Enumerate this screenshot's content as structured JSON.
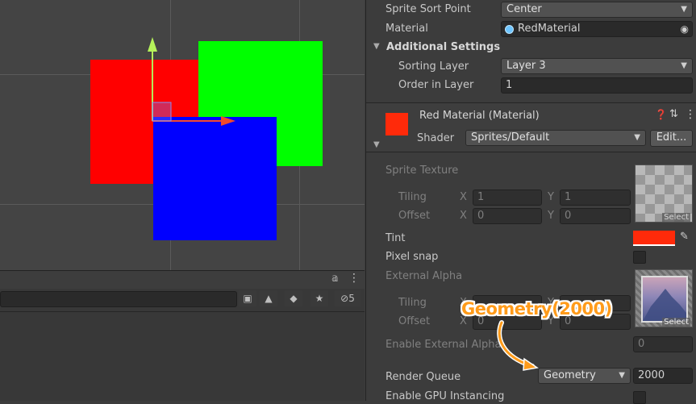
{
  "scene": {
    "colors": {
      "red": "#ff0000",
      "green": "#00ff00",
      "blue": "#0000ff",
      "background": "#444444"
    },
    "gizmo": {
      "y_axis_color": "#b5f25a",
      "x_axis_color": "#f14a2c"
    }
  },
  "lower_panel": {
    "corner_icons": [
      "account-icon",
      "more-vert-icon"
    ],
    "toolbar_icons": [
      "search-scene-icon",
      "shapes-icon",
      "tag-icon",
      "favorite-icon",
      "visibility-off-icon"
    ],
    "hidden_count": "5"
  },
  "inspector": {
    "sprite_sort_point": {
      "label": "Sprite Sort Point",
      "value": "Center"
    },
    "material": {
      "label": "Material",
      "value": "RedMaterial"
    },
    "additional_settings": {
      "label": "Additional Settings"
    },
    "sorting_layer": {
      "label": "Sorting Layer",
      "value": "Layer 3"
    },
    "order_in_layer": {
      "label": "Order in Layer",
      "value": "1"
    },
    "material_header": {
      "title": "Red Material (Material)",
      "swatch_color": "#ff2a0a",
      "shader_label": "Shader",
      "shader_value": "Sprites/Default",
      "edit_label": "Edit..."
    },
    "sprite_texture": {
      "label": "Sprite Texture",
      "tiling": {
        "label": "Tiling",
        "x_label": "X",
        "x": "1",
        "y_label": "Y",
        "y": "1"
      },
      "offset": {
        "label": "Offset",
        "x_label": "X",
        "x": "0",
        "y_label": "Y",
        "y": "0"
      },
      "select_label": "Select"
    },
    "tint": {
      "label": "Tint",
      "color": "#ff2a0a"
    },
    "pixel_snap": {
      "label": "Pixel snap"
    },
    "external_alpha": {
      "label": "External Alpha",
      "tiling": {
        "label": "Tiling",
        "x_label": "X",
        "y_label": "Y"
      },
      "offset": {
        "label": "Offset",
        "x_label": "X",
        "x": "0",
        "y_label": "Y",
        "y": "0"
      },
      "select_label": "Select"
    },
    "enable_external_alpha": {
      "label": "Enable External Alpha",
      "value": "0"
    },
    "render_queue": {
      "label": "Render Queue",
      "mode": "Geometry",
      "value": "2000"
    },
    "gpu_instancing": {
      "label": "Enable GPU Instancing"
    }
  },
  "annotation": {
    "text": "Geometry(2000)",
    "color": "#ff9b1a"
  }
}
